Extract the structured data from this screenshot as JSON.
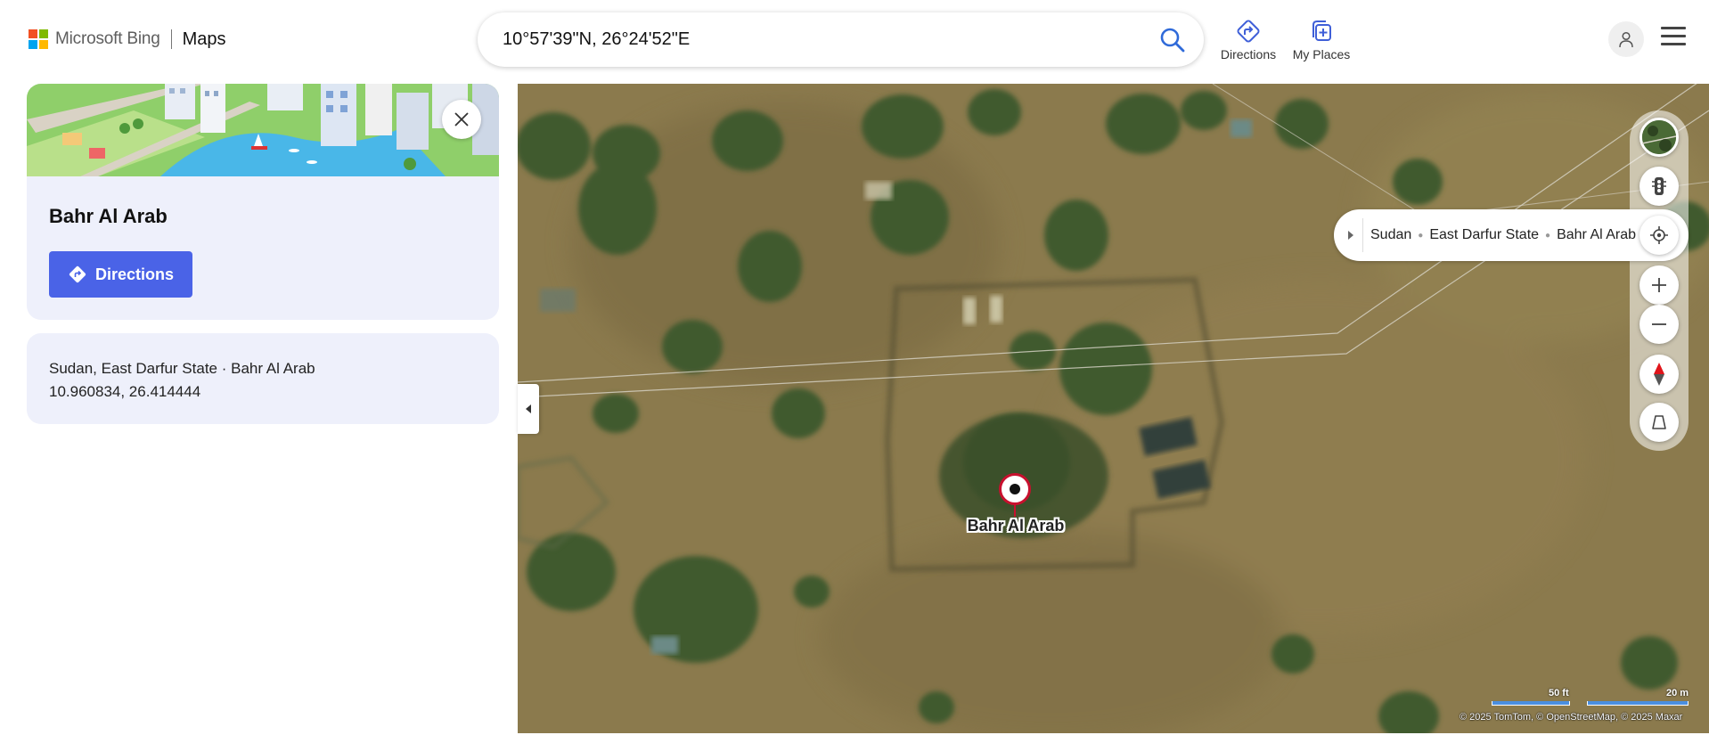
{
  "header": {
    "brand": "Microsoft Bing",
    "product": "Maps",
    "search_value": "10°57'39\"N, 26°24'52\"E",
    "directions_label": "Directions",
    "my_places_label": "My Places"
  },
  "place_card": {
    "title": "Bahr Al Arab",
    "directions_button": "Directions"
  },
  "info_card": {
    "location": "Sudan, East Darfur State · Bahr Al Arab",
    "coordinates": "10.960834, 26.414444"
  },
  "map": {
    "pin_label": "Bahr Al Arab",
    "breadcrumb": [
      "Sudan",
      "East Darfur State",
      "Bahr Al Arab"
    ],
    "scale_imperial": "50 ft",
    "scale_metric": "20 m",
    "copyright": "© 2025 TomTom, © OpenStreetMap, © 2025 Maxar"
  },
  "colors": {
    "accent": "#4a63e7",
    "panel_bg": "#eef0fb",
    "pin_red": "#c8102e",
    "terrain": "#8a7a4e",
    "vegetation": "#3f5a2f"
  },
  "icons": {
    "search": "search-icon",
    "directions": "directions-icon",
    "my_places": "my-places-icon",
    "avatar": "person-icon",
    "menu": "hamburger-icon",
    "close": "close-icon",
    "traffic": "traffic-icon",
    "locate": "locate-icon",
    "zoom_in": "plus-icon",
    "zoom_out": "minus-icon",
    "compass": "compass-icon",
    "tilt": "tilt-icon"
  }
}
